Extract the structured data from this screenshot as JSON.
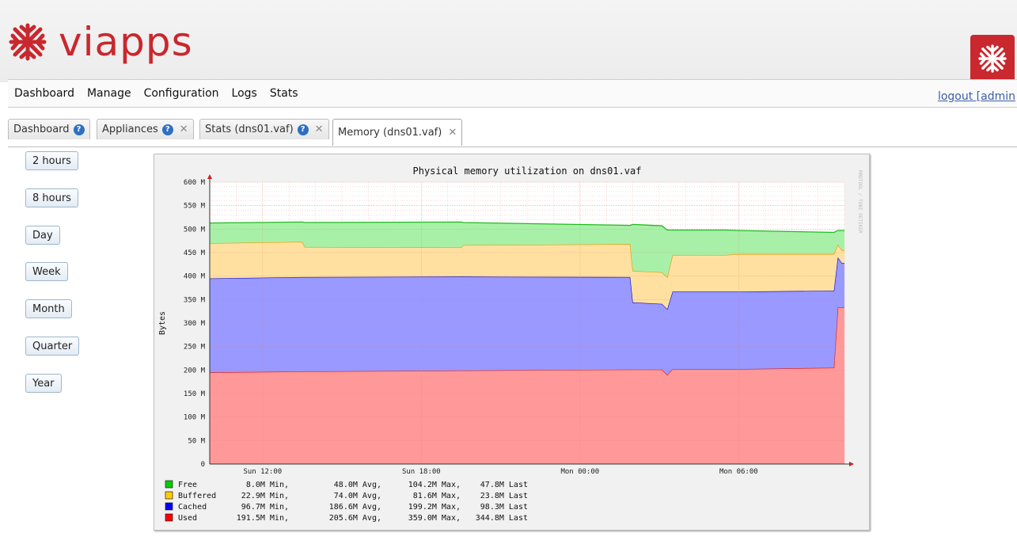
{
  "brand": {
    "name": "viapps"
  },
  "header": {
    "logout_label": "logout [admin"
  },
  "menu": [
    "Dashboard",
    "Manage",
    "Configuration",
    "Logs",
    "Stats"
  ],
  "tabs": [
    {
      "label": "Dashboard",
      "help": true,
      "closable": false
    },
    {
      "label": "Appliances",
      "help": true,
      "closable": true
    },
    {
      "label": "Stats (dns01.vaf)",
      "help": true,
      "closable": true
    },
    {
      "label": "Memory (dns01.vaf)",
      "help": false,
      "closable": true,
      "active": true
    }
  ],
  "ranges": [
    "2 hours",
    "8 hours",
    "Day",
    "Week",
    "Month",
    "Quarter",
    "Year"
  ],
  "icons": {
    "help": "question-circle-icon",
    "close": "close-x-icon",
    "logo": "red-snowflake-icon"
  },
  "colors": {
    "brand": "#c8282e",
    "free": "#00cc00",
    "buffered": "#ffcc00",
    "cached": "#0000ff",
    "used": "#ff0000"
  },
  "chart_data": {
    "type": "area",
    "stacked": true,
    "title": "Physical memory utilization on dns01.vaf",
    "ylabel": "Bytes",
    "watermark": "RRDTOOL / TOBI OETIKER",
    "ylim": [
      0,
      600
    ],
    "yticks": [
      {
        "value": 0,
        "label": "0"
      },
      {
        "value": 50,
        "label": "50 M"
      },
      {
        "value": 100,
        "label": "100 M"
      },
      {
        "value": 150,
        "label": "150 M"
      },
      {
        "value": 200,
        "label": "200 M"
      },
      {
        "value": 250,
        "label": "250 M"
      },
      {
        "value": 300,
        "label": "300 M"
      },
      {
        "value": 350,
        "label": "350 M"
      },
      {
        "value": 400,
        "label": "400 M"
      },
      {
        "value": 450,
        "label": "450 M"
      },
      {
        "value": 500,
        "label": "500 M"
      },
      {
        "value": 550,
        "label": "550 M"
      },
      {
        "value": 600,
        "label": "600 M"
      }
    ],
    "xlim": [
      10,
      34
    ],
    "xticks": [
      {
        "value": 12,
        "label": "Sun 12:00"
      },
      {
        "value": 18,
        "label": "Sun 18:00"
      },
      {
        "value": 24,
        "label": "Mon 00:00"
      },
      {
        "value": 30,
        "label": "Mon 06:00"
      }
    ],
    "x": [
      10,
      13.5,
      13.6,
      19.5,
      19.6,
      25.9,
      26.0,
      27.1,
      27.3,
      27.5,
      29.5,
      30.0,
      33.6,
      33.75,
      33.9,
      34
    ],
    "series": [
      {
        "name": "Used",
        "values": [
          195,
          197,
          197,
          199,
          199,
          201,
          201,
          201,
          190,
          202,
          202,
          202,
          205,
          333,
          333,
          333
        ]
      },
      {
        "name": "Cached",
        "values": [
          200,
          201,
          201,
          200,
          200,
          197,
          143,
          140,
          140,
          165,
          165,
          165,
          164,
          107,
          95,
          95
        ]
      },
      {
        "name": "Buffered",
        "values": [
          75,
          75,
          64,
          62,
          67,
          70,
          67,
          67,
          68,
          78,
          78,
          80,
          78,
          27,
          27,
          27
        ]
      },
      {
        "name": "Free",
        "values": [
          43,
          42,
          52,
          54,
          48,
          40,
          99,
          99,
          100,
          53,
          53,
          50,
          46,
          30,
          42,
          42
        ]
      }
    ],
    "legend": [
      {
        "name": "Free",
        "min": "8.0M",
        "avg": "48.0M",
        "max": "104.2M",
        "last": "47.8M"
      },
      {
        "name": "Buffered",
        "min": "22.9M",
        "avg": "74.0M",
        "max": "81.6M",
        "last": "23.8M"
      },
      {
        "name": "Cached",
        "min": "96.7M",
        "avg": "186.6M",
        "max": "199.2M",
        "last": "98.3M"
      },
      {
        "name": "Used",
        "min": "191.5M",
        "avg": "205.6M",
        "max": "359.0M",
        "last": "344.8M"
      }
    ],
    "legend_suffixes": {
      "min": "Min,",
      "avg": "Avg,",
      "max": "Max,",
      "last": "Last"
    }
  }
}
